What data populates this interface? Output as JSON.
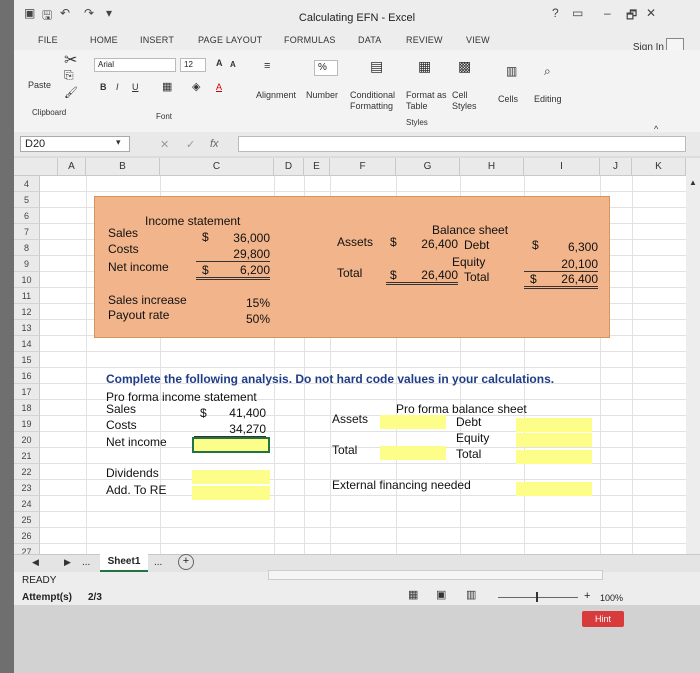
{
  "window": {
    "title": "Calculating EFN - Excel",
    "help": "?",
    "minimize": "–",
    "restore": "🗗",
    "close": "✕",
    "sign_in": "Sign In"
  },
  "ribbon_tabs": [
    "FILE",
    "HOME",
    "INSERT",
    "PAGE LAYOUT",
    "FORMULAS",
    "DATA",
    "REVIEW",
    "VIEW"
  ],
  "ribbon": {
    "paste": "Paste",
    "clipboard": "Clipboard",
    "font_name": "Arial",
    "font_size": "12",
    "bold": "B",
    "italic": "I",
    "underline": "U",
    "grow_font": "A",
    "shrink_font": "A",
    "font_color": "A",
    "font_group": "Font",
    "percent": "%",
    "alignment": "Alignment",
    "number": "Number",
    "conditional_formatting": "Conditional\nFormatting",
    "format_as_table": "Format as\nTable",
    "cell_styles": "Cell\nStyles",
    "styles_group": "Styles",
    "cells": "Cells",
    "editing": "Editing"
  },
  "formula_bar": {
    "name_box": "D20",
    "fx": "fx",
    "cancel": "✕",
    "enter": "✓"
  },
  "columns": [
    "A",
    "B",
    "C",
    "D",
    "E",
    "F",
    "G",
    "H",
    "I",
    "J",
    "K"
  ],
  "rows": [
    "4",
    "5",
    "6",
    "7",
    "8",
    "9",
    "10",
    "11",
    "12",
    "13",
    "14",
    "15",
    "16",
    "17",
    "18",
    "19",
    "20",
    "21",
    "22",
    "23",
    "24",
    "25",
    "26",
    "27"
  ],
  "income_statement": {
    "title": "Income statement",
    "sales_label": "Sales",
    "sales_dollar": "$",
    "sales_value": "36,000",
    "costs_label": "Costs",
    "costs_value": "29,800",
    "ni_label": "Net income",
    "ni_dollar": "$",
    "ni_value": "6,200"
  },
  "balance_sheet": {
    "title": "Balance sheet",
    "assets_label": "Assets",
    "assets_dollar": "$",
    "assets_value": "26,400",
    "debt_label": "Debt",
    "debt_dollar": "$",
    "debt_value": "6,300",
    "equity_label": "Equity",
    "equity_value": "20,100",
    "total_label": "Total",
    "total_dollar": "$",
    "total_value": "26,400",
    "total2_label": "Total",
    "total2_dollar": "$",
    "total2_value": "26,400"
  },
  "ratios": {
    "sales_increase_label": "Sales increase",
    "sales_increase_value": "15%",
    "payout_label": "Payout rate",
    "payout_value": "50%"
  },
  "instruction": "Complete the following analysis. Do not hard code values in your calculations.",
  "pro_forma_is": {
    "title": "Pro forma income statement",
    "sales_label": "Sales",
    "sales_dollar": "$",
    "sales_value": "41,400",
    "costs_label": "Costs",
    "costs_value": "34,270",
    "ni_label": "Net income",
    "dividends_label": "Dividends",
    "add_re_label": "Add. To RE"
  },
  "pro_forma_bs": {
    "title": "Pro forma balance sheet",
    "assets_label": "Assets",
    "debt_label": "Debt",
    "equity_label": "Equity",
    "total_label": "Total",
    "total2_label": "Total",
    "efn_label": "External financing needed"
  },
  "sheet_tabs": {
    "active": "Sheet1",
    "more": "...",
    "add": "+"
  },
  "status": {
    "ready": "READY",
    "attempts_label": "Attempt(s)",
    "attempts_value": "2/3",
    "zoom": "100%",
    "hint": "Hint"
  },
  "colors": {
    "accent": "#217346",
    "input_fill": "#fdfd8a",
    "box_fill": "#f2b48a",
    "hint": "#d83b3b"
  }
}
